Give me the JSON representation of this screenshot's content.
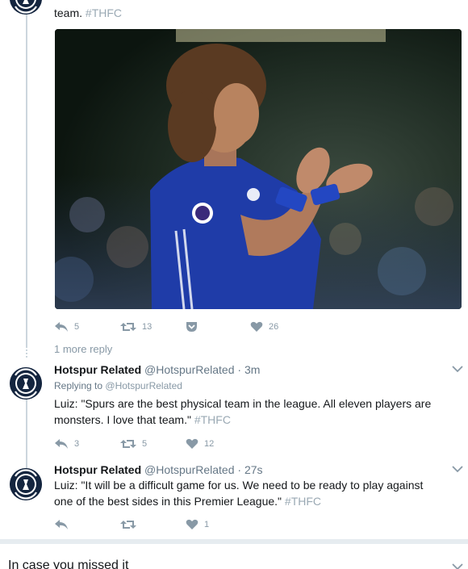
{
  "top_tweet": {
    "text_tail": "team.",
    "hashtag": "#THFC",
    "actions": {
      "reply_count": "5",
      "retweet_count": "13",
      "like_count": "26"
    }
  },
  "more_reply": "1 more reply",
  "tweets": [
    {
      "name": "Hotspur Related",
      "handle": "@HotspurRelated",
      "dot": "·",
      "time": "3m",
      "replying_prefix": "Replying to",
      "replying_handle": "@HotspurRelated",
      "text_line1": "Luiz: \"Spurs are the best physical team in the league. All eleven players are",
      "text_line2": "monsters. I love that team.\"",
      "hashtag": "#THFC",
      "reply_count": "3",
      "retweet_count": "5",
      "like_count": "12"
    },
    {
      "name": "Hotspur Related",
      "handle": "@HotspurRelated",
      "dot": "·",
      "time": "27s",
      "text_line1": "Luiz: \"It will be a difficult game for us. We need to be ready to play against",
      "text_line2": "one of the best sides in this Premier League.\"",
      "hashtag": "#THFC",
      "reply_count": "",
      "retweet_count": "",
      "like_count": "1"
    }
  ],
  "section_header": "In case you missed it",
  "colors": {
    "text": "#14171a",
    "muted": "#657786",
    "icon": "#8899a6",
    "thread_line": "#ccd6dd",
    "avatar_bg": "#14253f"
  },
  "icons": {
    "reply": "reply-arrow-icon",
    "retweet": "retweet-icon",
    "save": "pocket-save-icon",
    "like": "heart-icon",
    "caret": "chevron-down-icon"
  }
}
